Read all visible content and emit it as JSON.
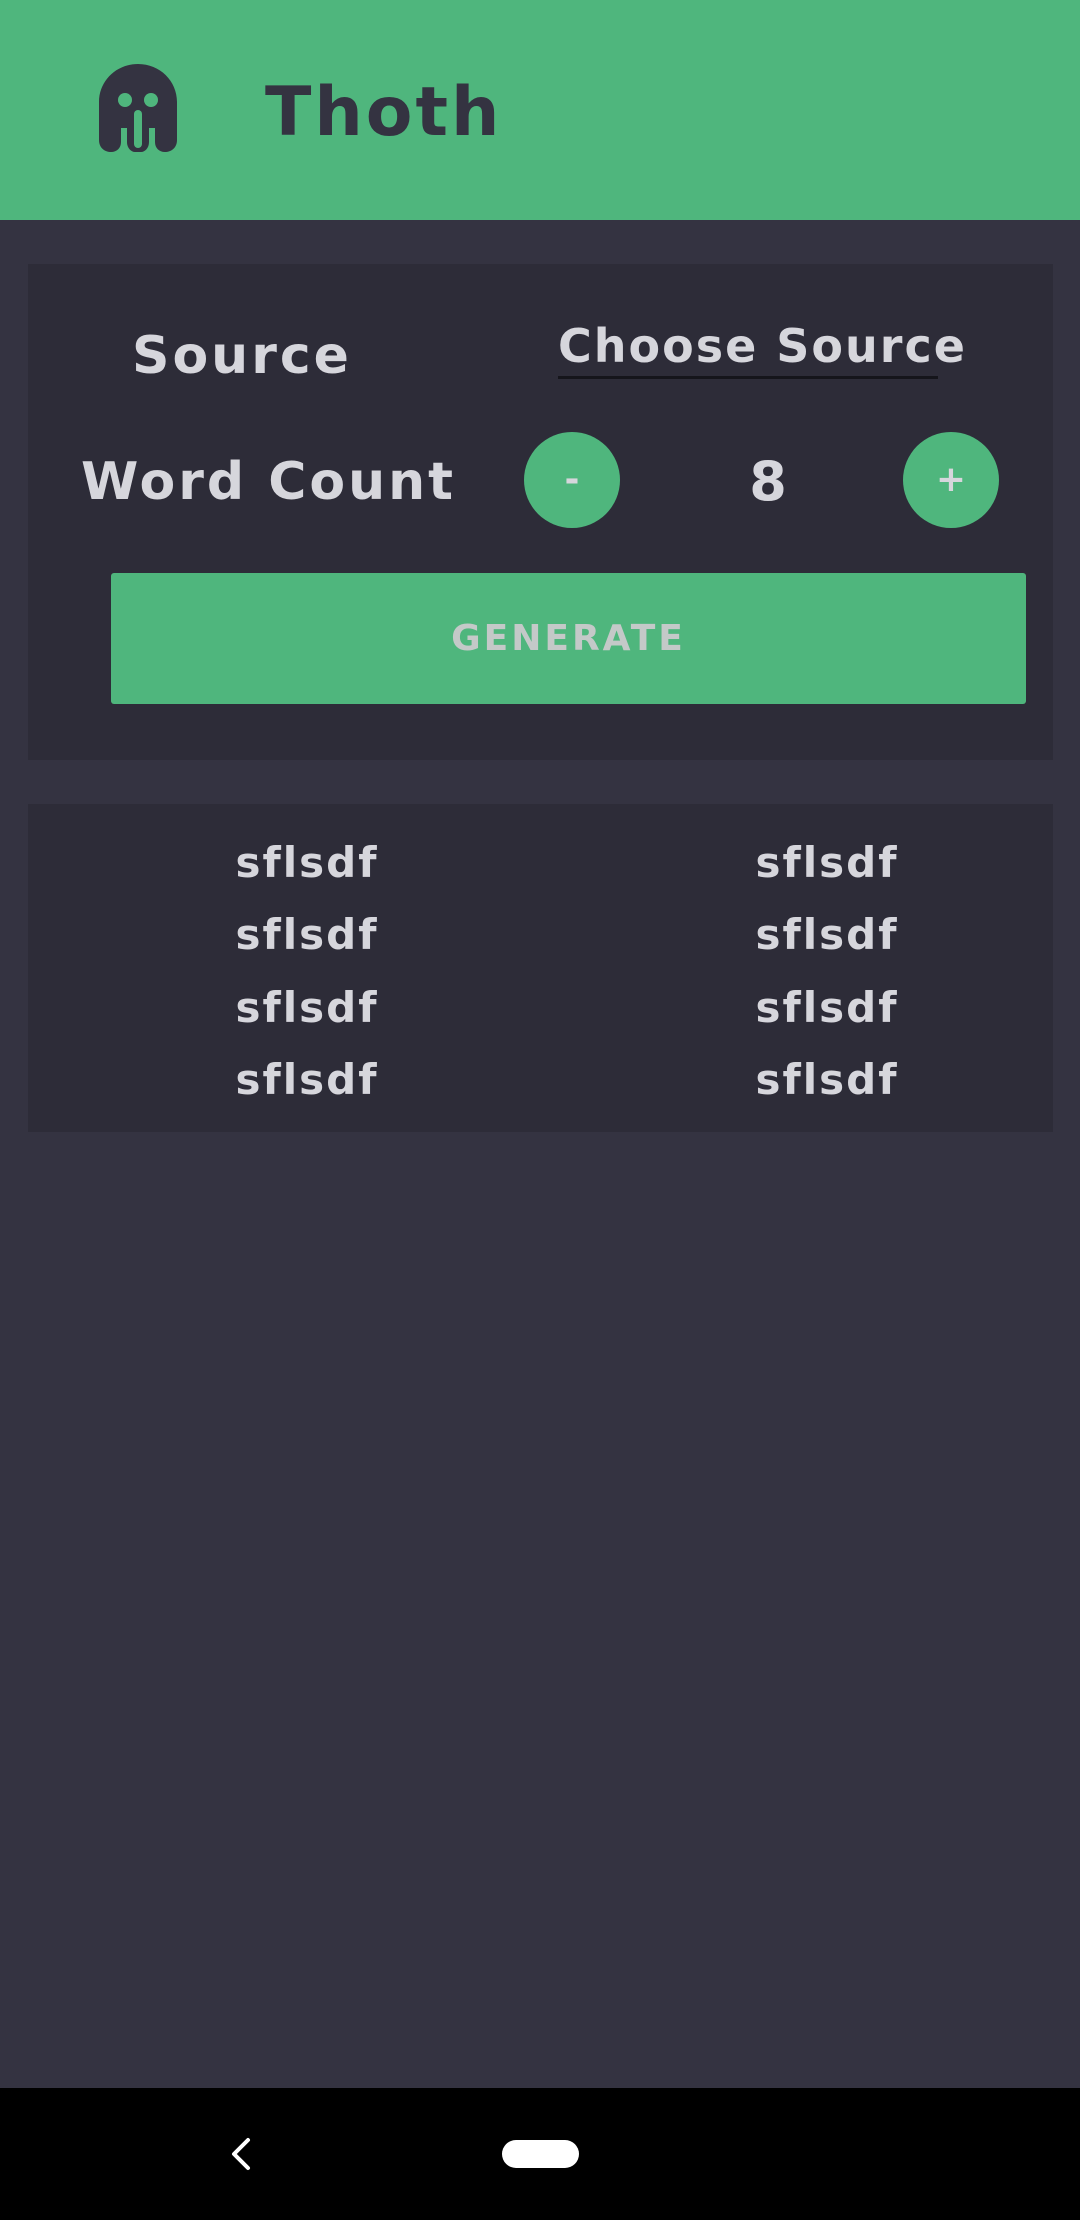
{
  "app_bar": {
    "title": "Thoth",
    "logo_icon": "ghost-logo-icon",
    "background": "#4fb67d"
  },
  "settings": {
    "source_label": "Source",
    "source_value": "Choose Source",
    "word_count_label": "Word Count",
    "decrement_label": "-",
    "increment_label": "+",
    "word_count_value": "8",
    "generate_label": "GENERATE"
  },
  "words": [
    "sflsdf",
    "sflsdf",
    "sflsdf",
    "sflsdf",
    "sflsdf",
    "sflsdf",
    "sflsdf",
    "sflsdf"
  ],
  "nav": {
    "back_icon": "back-chevron-icon",
    "home_icon": "home-pill-icon"
  },
  "colors": {
    "accent": "#4fb67d",
    "background": "#343341",
    "card": "#2d2c38",
    "text": "#d6d6dc"
  }
}
